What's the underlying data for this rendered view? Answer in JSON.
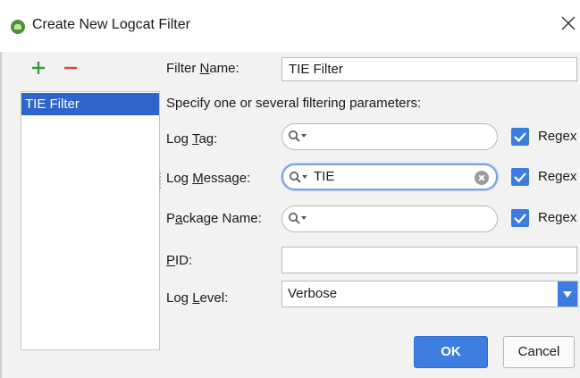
{
  "window": {
    "title": "Create New Logcat Filter",
    "icon": "android-studio-icon"
  },
  "toolbar": {
    "add_icon": "plus-icon",
    "remove_icon": "minus-icon"
  },
  "filters": {
    "items": [
      {
        "label": "TIE Filter",
        "selected": true
      }
    ]
  },
  "form": {
    "filter_name": {
      "label_pre": "Filter ",
      "label_mnemonic": "N",
      "label_post": "ame:",
      "value": "TIE Filter"
    },
    "instruction": "Specify one or several filtering parameters:",
    "log_tag": {
      "label_pre": "Log ",
      "label_mnemonic": "T",
      "label_post": "ag:",
      "value": "",
      "regex_label": "Regex",
      "regex_checked": true
    },
    "log_message": {
      "label_pre": "Log ",
      "label_mnemonic": "M",
      "label_post": "essage:",
      "value": "TIE",
      "regex_label": "Regex",
      "regex_checked": true
    },
    "package_name": {
      "label_pre": "P",
      "label_mnemonic": "a",
      "label_post": "ckage Name:",
      "value": "",
      "regex_label": "Regex",
      "regex_checked": true
    },
    "pid": {
      "label_pre": "",
      "label_mnemonic": "P",
      "label_post": "ID:",
      "value": ""
    },
    "log_level": {
      "label_pre": "Log ",
      "label_mnemonic": "L",
      "label_post": "evel:",
      "value": "Verbose"
    }
  },
  "buttons": {
    "ok": "OK",
    "cancel": "Cancel"
  },
  "colors": {
    "accent": "#3c7ce0",
    "selection": "#2f65ca",
    "add": "#3a9b3a",
    "remove": "#d9473d"
  }
}
